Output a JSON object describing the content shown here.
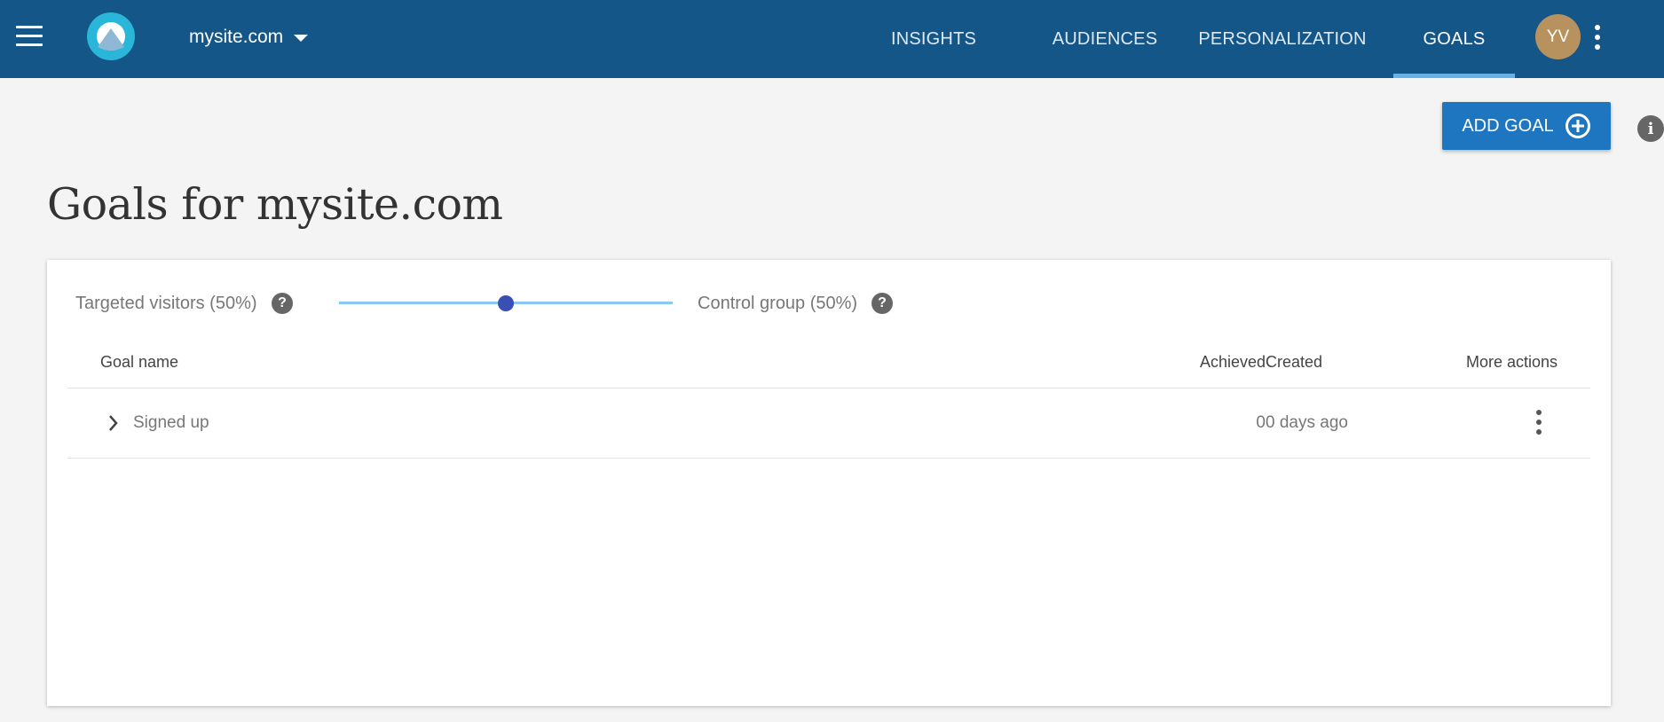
{
  "header": {
    "site_name": "mysite.com",
    "nav_tabs": [
      {
        "label": "INSIGHTS",
        "active": false
      },
      {
        "label": "AUDIENCES",
        "active": false
      },
      {
        "label": "PERSONALIZATION",
        "active": false
      },
      {
        "label": "GOALS",
        "active": true
      }
    ],
    "user_initials": "YV"
  },
  "actions": {
    "add_goal_label": "ADD GOAL",
    "info_glyph": "i"
  },
  "page": {
    "title": "Goals for mysite.com"
  },
  "split": {
    "targeted_label": "Targeted visitors (50%)",
    "control_label": "Control group (50%)",
    "help_glyph": "?",
    "targeted_percent": 50
  },
  "table": {
    "columns": {
      "goal_name": "Goal name",
      "achieved": "Achieved",
      "created": "Created",
      "more_actions": "More actions"
    },
    "rows": [
      {
        "goal_name": "Signed up",
        "achieved": "0",
        "created": "0 days ago"
      }
    ]
  },
  "colors": {
    "topbar": "#155689",
    "active_tab_indicator": "#63b3e8",
    "primary_button": "#1f76c0",
    "avatar": "#b8925e",
    "slider_thumb": "#3a4fb3",
    "slider_track": "#88c9f0"
  },
  "icons": [
    "hamburger-icon",
    "logo-icon",
    "caret-down-icon",
    "kebab-icon",
    "plus-circle-icon",
    "info-icon",
    "help-icon",
    "chevron-right-icon"
  ]
}
